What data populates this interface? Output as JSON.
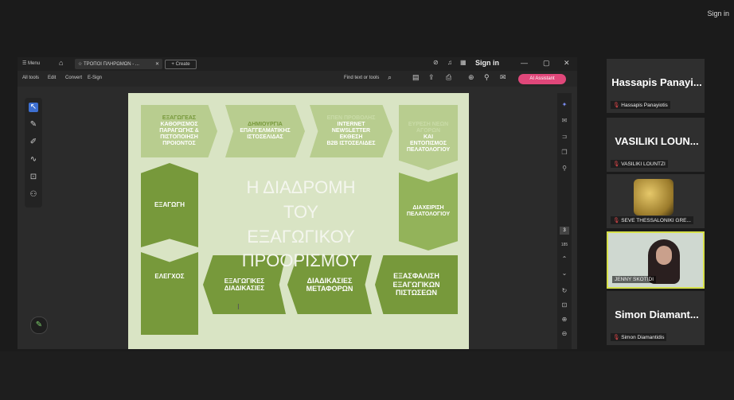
{
  "top": {
    "sign_in": "Sign in"
  },
  "tabbar": {
    "menu": "☰ Menu",
    "home": "⌂",
    "tab_title": "☆ ΤΡΟΠΟΙ ΠΛΗΡΩΜΩΝ - ...",
    "tab_close": "✕",
    "create": "+ Create",
    "sign_in": "Sign in",
    "minimize": "—",
    "maximize": "▢",
    "close": "✕"
  },
  "toolbar": {
    "all_tools": "All tools",
    "edit": "Edit",
    "convert": "Convert",
    "esign": "E-Sign",
    "find": "Find text or tools",
    "ai": "AI Assistant"
  },
  "slide": {
    "title_lines": [
      "Η ΔΙΑΔΡΟΜΗ",
      "ΤΟΥ ΕΞΑΓΩΓΙΚΟΥ",
      "ΠΡΟΟΡΙΣΜΟΥ"
    ],
    "box1": [
      "ΕΞΑΓΩΓΕΑΣ",
      "ΚΑΘΟΡΙΣΜΟΣ",
      "ΠΑΡΑΓΩΓΗΣ &",
      "ΠΙΣΤΟΠΟΙΗΣΗ",
      "ΠΡΟΙΟΝΤΟΣ"
    ],
    "box2": [
      "ΔΗΜΙΟΥΡΓΙΑ",
      "ΕΠΑΓΓΕΛΜΑΤΙΚΗΣ",
      "ΙΣΤΟΣΕΛΙΔΑΣ"
    ],
    "box3": [
      "ΕΠΕΝ ΠΡΟΒΟΛΗΣ",
      "INTERNET",
      "NEWSLETTER",
      "ΕΚΘΕΣΗ",
      "B2B ΙΣΤΟΣΕΛΙΔΕΣ"
    ],
    "box4": [
      "ΕΥΡΕΣΗ ΝΕΩΝ",
      "ΑΓΟΡΩΝ",
      "ΚΑΙ",
      "ΕΝΤΟΠΙΣΜΟΣ",
      "ΠΕΛΑΤΟΛΟΓΙΟΥ"
    ],
    "box5": [
      "ΔΙΑΧΕΙΡΙΣΗ",
      "ΠΕΛΑΤΟΛΟΓΙΟΥ"
    ],
    "box6": [
      "ΕΞΑΣΦΑΛΙΣΗ",
      "ΕΞΑΓΩΓΙΚΩΝ",
      "ΠΙΣΤΩΣΕΩΝ"
    ],
    "box7": [
      "ΔΙΑΔΙΚΑΣΙΕΣ",
      "ΜΕΤΑΦΟΡΩΝ"
    ],
    "box8": [
      "ΕΞΑΓΩΓΙΚΕΣ",
      "ΔΙΑΔΙΚΑΣΙΕΣ"
    ],
    "box9": [
      "ΕΛΕΓΧΟΣ"
    ],
    "box10": [
      "ΕΞΑΓΩΓΗ"
    ]
  },
  "pager": {
    "page": "3",
    "total": "185"
  },
  "participants": [
    {
      "display": "Hassapis Panayi...",
      "name": "Hassapis Panayiotis"
    },
    {
      "display": "VASILIKI LOUN...",
      "name": "VASILIKI LOUNTZI"
    },
    {
      "display": "",
      "name": "SEVE THESSALONIKI GRE..."
    },
    {
      "display": "",
      "name": "JENNY SKOTIDI"
    },
    {
      "display": "Simon Diamant...",
      "name": "Simon Diamantidis"
    }
  ],
  "colors": {
    "slide_bg": "#d9e4c4",
    "dark_green": "#77993b",
    "mid_green": "#93b35a",
    "light_green": "#b8cd8f",
    "speaker_border": "#d6e04a"
  }
}
